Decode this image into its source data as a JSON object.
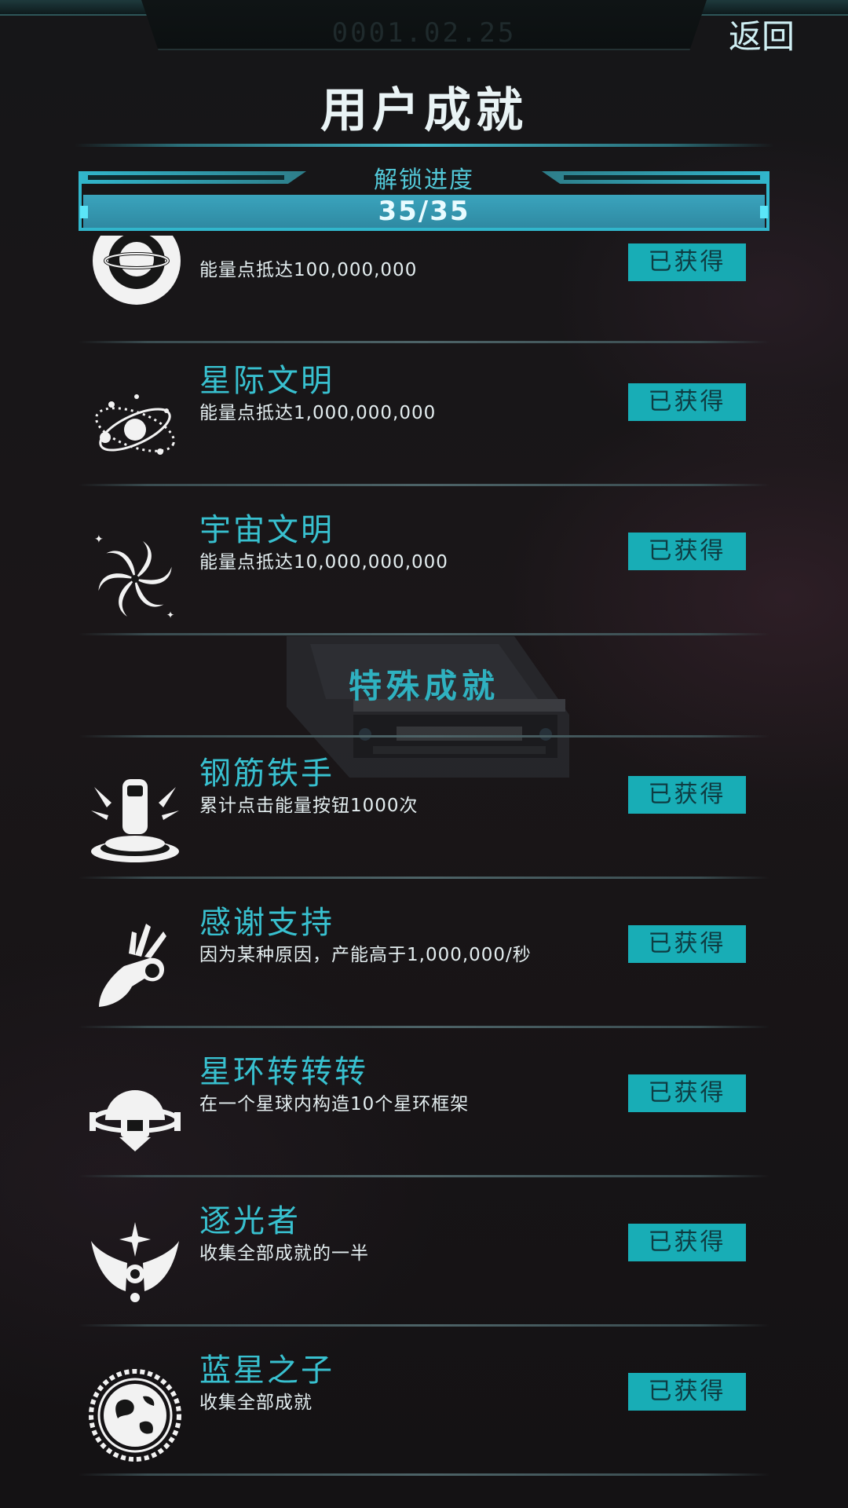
{
  "header": {
    "time": "0001.02.25",
    "back_label": "返回",
    "title": "用户成就"
  },
  "progress": {
    "label": "解锁进度",
    "value_text": "35/35",
    "fraction": 1.0
  },
  "colors": {
    "accent": "#38c0cf",
    "badge_bg": "#18adb6",
    "badge_text": "#0e3c42"
  },
  "achievements_top": [
    {
      "title": "",
      "desc": "能量点抵达100,000,000",
      "badge": "已获得",
      "icon": "planet-ring-icon"
    },
    {
      "title": "星际文明",
      "desc": "能量点抵达1,000,000,000",
      "badge": "已获得",
      "icon": "orbit-system-icon"
    },
    {
      "title": "宇宙文明",
      "desc": "能量点抵达10,000,000,000",
      "badge": "已获得",
      "icon": "spiral-galaxy-icon"
    }
  ],
  "special_section": {
    "title": "特殊成就"
  },
  "achievements_special": [
    {
      "title": "钢筋铁手",
      "desc": "累计点击能量按钮1000次",
      "badge": "已获得",
      "icon": "tap-finger-icon"
    },
    {
      "title": "感谢支持",
      "desc": "因为某种原因，产能高于1,000,000/秒",
      "badge": "已获得",
      "icon": "ok-hand-icon"
    },
    {
      "title": "星环转转转",
      "desc": "在一个星球内构造10个星环框架",
      "badge": "已获得",
      "icon": "ring-station-icon"
    },
    {
      "title": "逐光者",
      "desc": "收集全部成就的一半",
      "badge": "已获得",
      "icon": "winged-star-icon"
    },
    {
      "title": "蓝星之子",
      "desc": "收集全部成就",
      "badge": "已获得",
      "icon": "earth-seal-icon"
    }
  ]
}
